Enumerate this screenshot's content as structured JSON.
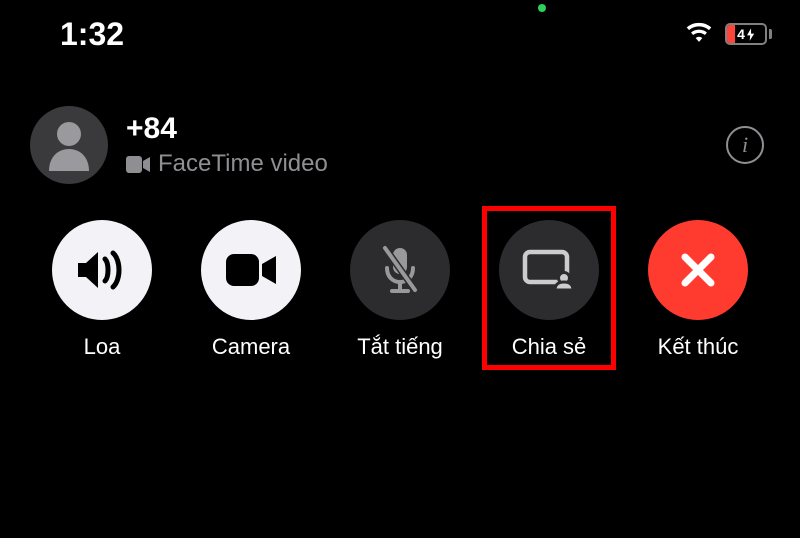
{
  "statusbar": {
    "time": "1:32",
    "battery_level": "4",
    "battery_percent": 20
  },
  "caller": {
    "name": "+84",
    "subtitle": "FaceTime video"
  },
  "controls": {
    "speaker": {
      "label": "Loa"
    },
    "camera": {
      "label": "Camera"
    },
    "mute": {
      "label": "Tắt tiếng"
    },
    "share": {
      "label": "Chia sẻ"
    },
    "end": {
      "label": "Kết thúc"
    }
  }
}
